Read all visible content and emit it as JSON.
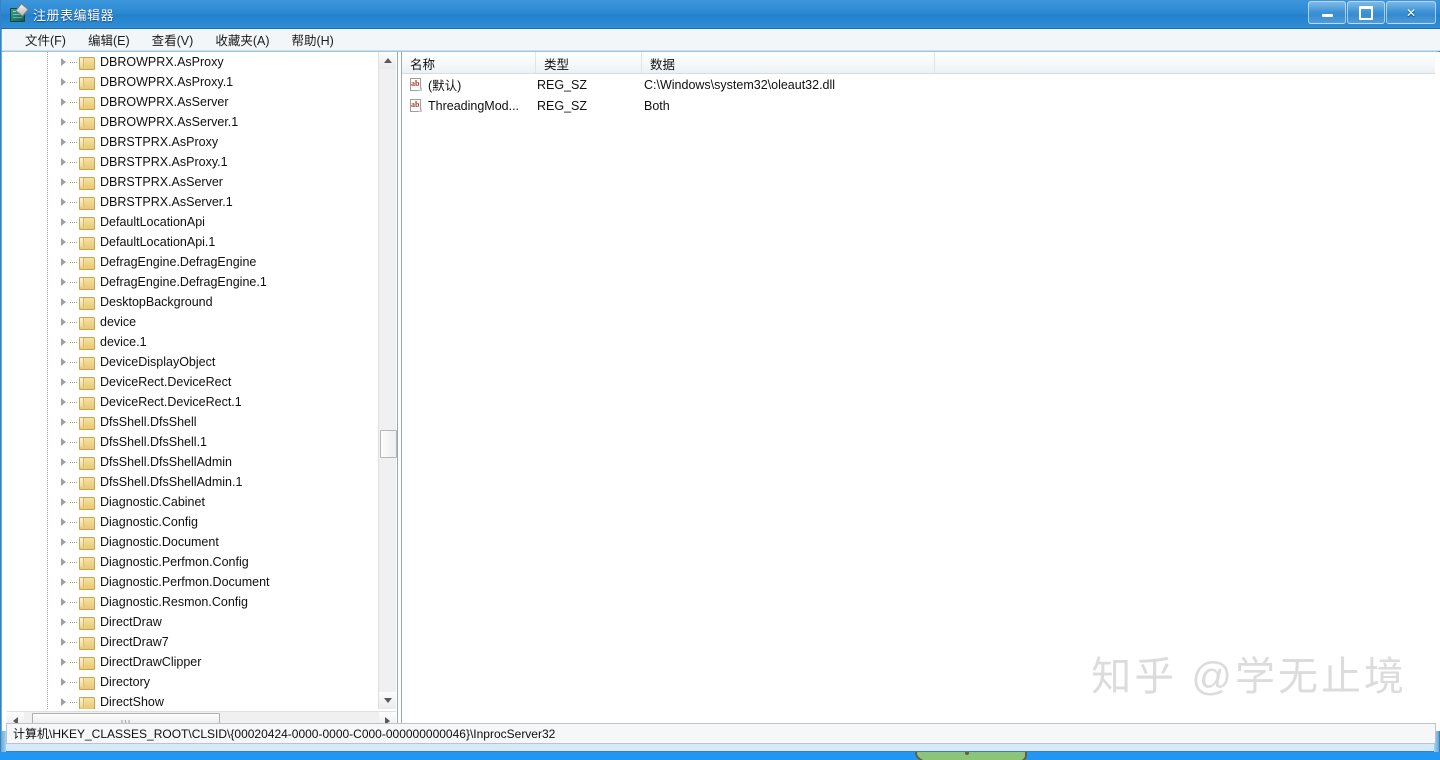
{
  "window": {
    "title": "注册表编辑器",
    "app_icon": "regedit-icon",
    "controls": {
      "minimize": "minimize-icon",
      "maximize": "maximize-icon",
      "close": "✕"
    }
  },
  "menubar": {
    "items": [
      {
        "label": "文件(F)"
      },
      {
        "label": "编辑(E)"
      },
      {
        "label": "查看(V)"
      },
      {
        "label": "收藏夹(A)"
      },
      {
        "label": "帮助(H)"
      }
    ]
  },
  "tree": {
    "items": [
      {
        "label": "DBROWPRX.AsProxy"
      },
      {
        "label": "DBROWPRX.AsProxy.1"
      },
      {
        "label": "DBROWPRX.AsServer"
      },
      {
        "label": "DBROWPRX.AsServer.1"
      },
      {
        "label": "DBRSTPRX.AsProxy"
      },
      {
        "label": "DBRSTPRX.AsProxy.1"
      },
      {
        "label": "DBRSTPRX.AsServer"
      },
      {
        "label": "DBRSTPRX.AsServer.1"
      },
      {
        "label": "DefaultLocationApi"
      },
      {
        "label": "DefaultLocationApi.1"
      },
      {
        "label": "DefragEngine.DefragEngine"
      },
      {
        "label": "DefragEngine.DefragEngine.1"
      },
      {
        "label": "DesktopBackground"
      },
      {
        "label": "device"
      },
      {
        "label": "device.1"
      },
      {
        "label": "DeviceDisplayObject"
      },
      {
        "label": "DeviceRect.DeviceRect"
      },
      {
        "label": "DeviceRect.DeviceRect.1"
      },
      {
        "label": "DfsShell.DfsShell"
      },
      {
        "label": "DfsShell.DfsShell.1"
      },
      {
        "label": "DfsShell.DfsShellAdmin"
      },
      {
        "label": "DfsShell.DfsShellAdmin.1"
      },
      {
        "label": "Diagnostic.Cabinet"
      },
      {
        "label": "Diagnostic.Config"
      },
      {
        "label": "Diagnostic.Document"
      },
      {
        "label": "Diagnostic.Perfmon.Config"
      },
      {
        "label": "Diagnostic.Perfmon.Document"
      },
      {
        "label": "Diagnostic.Resmon.Config"
      },
      {
        "label": "DirectDraw"
      },
      {
        "label": "DirectDraw7"
      },
      {
        "label": "DirectDrawClipper"
      },
      {
        "label": "Directory"
      },
      {
        "label": "DirectShow"
      }
    ],
    "scrollbar": {
      "grip": "ııı"
    }
  },
  "list": {
    "columns": [
      {
        "label": "名称"
      },
      {
        "label": "类型"
      },
      {
        "label": "数据"
      },
      {
        "label": ""
      }
    ],
    "rows": [
      {
        "icon": "string-value-icon",
        "icon_text": "ab",
        "name": "(默认)",
        "type": "REG_SZ",
        "data": "C:\\Windows\\system32\\oleaut32.dll"
      },
      {
        "icon": "string-value-icon",
        "icon_text": "ab",
        "name": "ThreadingMod...",
        "type": "REG_SZ",
        "data": "Both"
      }
    ]
  },
  "statusbar": {
    "path": "计算机\\HKEY_CLASSES_ROOT\\CLSID\\{00020424-0000-0000-C000-000000000046}\\InprocServer32"
  },
  "watermark": {
    "text": "知乎 @学无止境"
  },
  "colors": {
    "titlebar_blue": "#2b88d2",
    "window_frame": "#8fc4e8",
    "folder_yellow": "#e8c872",
    "ab_icon_red": "#b03a26",
    "watermark_grey": "#dcdcdc"
  }
}
